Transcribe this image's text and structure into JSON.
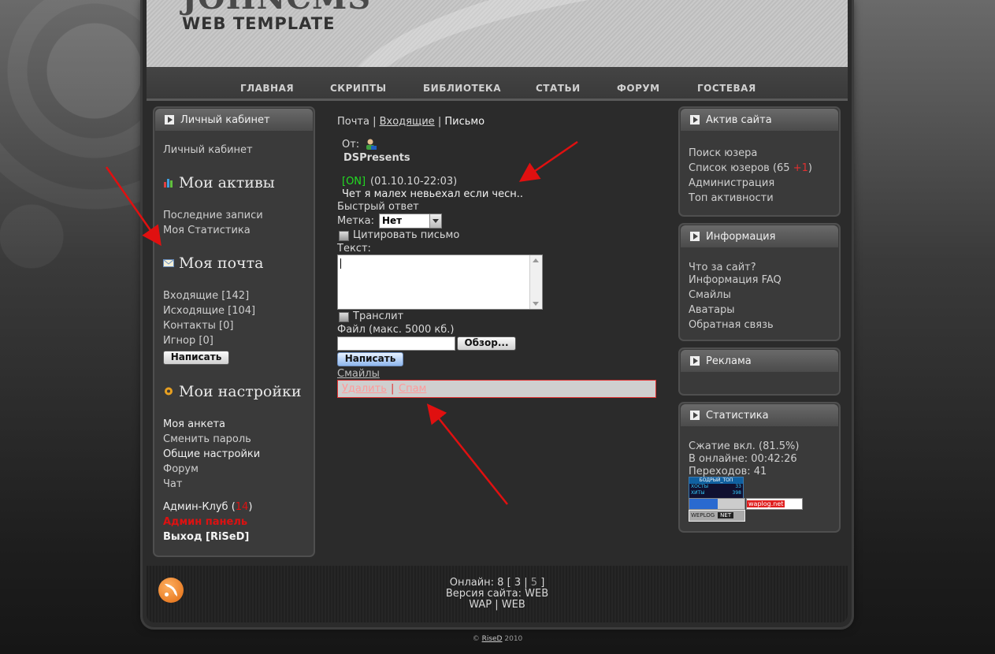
{
  "header": {
    "logo_top": "JOHNCMS",
    "logo_sub": "WEB TEMPLATE"
  },
  "nav": [
    "ГЛАВНАЯ",
    "СКРИПТЫ",
    "БИБЛИОТЕКА",
    "СТАТЬИ",
    "ФОРУМ",
    "ГОСТЕВАЯ"
  ],
  "left": {
    "cabinet_title": "Личный кабинет",
    "cabinet_link": "Личный кабинет",
    "assets_title": "Мои активы",
    "assets_items": [
      "Последние записи",
      "Моя Статистика"
    ],
    "mail_title": "Моя почта",
    "mail_items": [
      "Входящие [142]",
      "Исходящие [104]",
      "Контакты [0]",
      "Игнор [0]"
    ],
    "mail_button": "Написать",
    "settings_title": "Мои настройки",
    "settings_items": [
      "Моя анкета",
      "Сменить пароль",
      "Общие настройки",
      "Форум",
      "Чат"
    ],
    "admin_club": "Админ-Клуб (",
    "admin_club_count": "14",
    "admin_club_close": ")",
    "admin_panel": "Админ панель",
    "logout": "Выход [RiSeD]"
  },
  "main": {
    "breadcrumb": [
      "Почта",
      "Входящие",
      "Письмо"
    ],
    "from_label": "От:",
    "from_name": "DSPresents",
    "status": "[ON]",
    "date": "(01.10.10-22:03)",
    "message": "Чет я малех невьехал если чесн..",
    "quick_reply": "Быстрый ответ",
    "label_label": "Метка:",
    "label_value": "Нет",
    "quote_label": "Цитировать письмо",
    "text_label": "Текст:",
    "translit_label": "Транслит",
    "file_label": "Файл (макс. 5000 кб.)",
    "browse_button": "Обзор...",
    "submit_button": "Написать",
    "smiles_link": "Смайлы",
    "delete_link": "Удалить",
    "spam_link": "Спам"
  },
  "right": {
    "active_title": "Актив сайта",
    "active_items": [
      "Поиск юзера",
      "Список юзеров (65 ",
      "Администрация",
      "Топ активности"
    ],
    "active_new": "+1",
    "info_title": "Информация",
    "info_items": [
      "Что за сайт?",
      "Информация FAQ",
      "Смайлы",
      "Аватары",
      "Обратная связь"
    ],
    "ads_title": "Реклама",
    "stats_title": "Статистика",
    "stats_items": [
      "Сжатие вкл. (81.5%)",
      "В онлайне: 00:42:26",
      "Переходов: 41"
    ],
    "banner_top": "БОДРЫЙ_ТОП",
    "banner_hosts": "ХОСТЫ",
    "banner_hosts_val": "33",
    "banner_hits": "ХИТЫ",
    "banner_hits_val": "398",
    "banner_waplog": "waplog.net",
    "banner_weplog": "WEPLOG",
    "banner_net": "NET"
  },
  "footer": {
    "online_prefix": "Онлайн: 8 [",
    "online_a": "3",
    "online_sep": "|",
    "online_b": "5",
    "online_suffix": "]",
    "version": "Версия сайта: WEB",
    "wap": "WAP",
    "web": "WEB",
    "copyright_prefix": "©",
    "copyright_name": "RiseD",
    "copyright_year": "2010"
  },
  "colors": {
    "online_status": "#22dd22",
    "admin_red": "#dd1111",
    "arrow_red": "#e01010"
  }
}
